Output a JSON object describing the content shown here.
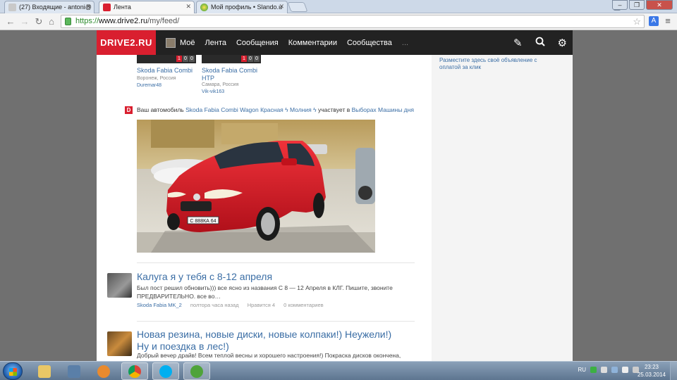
{
  "browser": {
    "tabs": [
      {
        "label": "(27) Входящие - antoni@",
        "active": false
      },
      {
        "label": "Лента",
        "active": true
      },
      {
        "label": "Мой профиль • Slando.u",
        "active": false
      }
    ],
    "url_scheme": "https://",
    "url_host": "www.drive2.ru",
    "url_path": "/my/feed/"
  },
  "site": {
    "logo": "DRIVE2.RU",
    "nav": [
      "Моё",
      "Лента",
      "Сообщения",
      "Комментарии",
      "Сообщества",
      "..."
    ],
    "icons": [
      "pencil-icon",
      "search-icon",
      "gear-icon"
    ]
  },
  "cars": [
    {
      "name": "Skoda Fabia Combi",
      "location": "Воронеж, Россия",
      "user": "Duremar48",
      "rating": [
        "1",
        "0",
        "0"
      ]
    },
    {
      "name": "Skoda Fabia Combi HTP",
      "location": "Самара, Россия",
      "user": "Vik-vik163",
      "rating": [
        "1",
        "0",
        "0"
      ]
    }
  ],
  "sidebar_ad": "Разместите здесь своё объявление с оплатой за клик",
  "notice": {
    "badge": "D",
    "prefix": "Ваш автомобиль",
    "car": "Skoda Fabia Combi Wagon Красная ϟ Молния ϟ",
    "middle": "участвует в",
    "contest": "Выборах Машины дня"
  },
  "photo": {
    "plate": "С 888КА 64"
  },
  "posts": [
    {
      "title": "Калуга я у тебя с 8-12 апреля",
      "text": "Был пост решил обновить))) все ясно из названия С 8 — 12 Апреля в КЛГ. Пишите, звоните ПРЕДВАРИТЕЛЬНО. все во…",
      "car": "Skoda Fabia MK_2",
      "time": "полтора часа назад",
      "likes": "Нравится 4",
      "comments": "0 комментариев"
    },
    {
      "title": "Новая резина, новые диски, новые колпаки!) Неужели!) Ну и поездка в лес!)",
      "text": "Добрый вечер драйв! Всем теплой весны и хорошего настроения!) Покраска дисков окончена,"
    }
  ],
  "taskbar": {
    "lang": "RU",
    "time": "23:23",
    "date": "25.03.2014"
  }
}
